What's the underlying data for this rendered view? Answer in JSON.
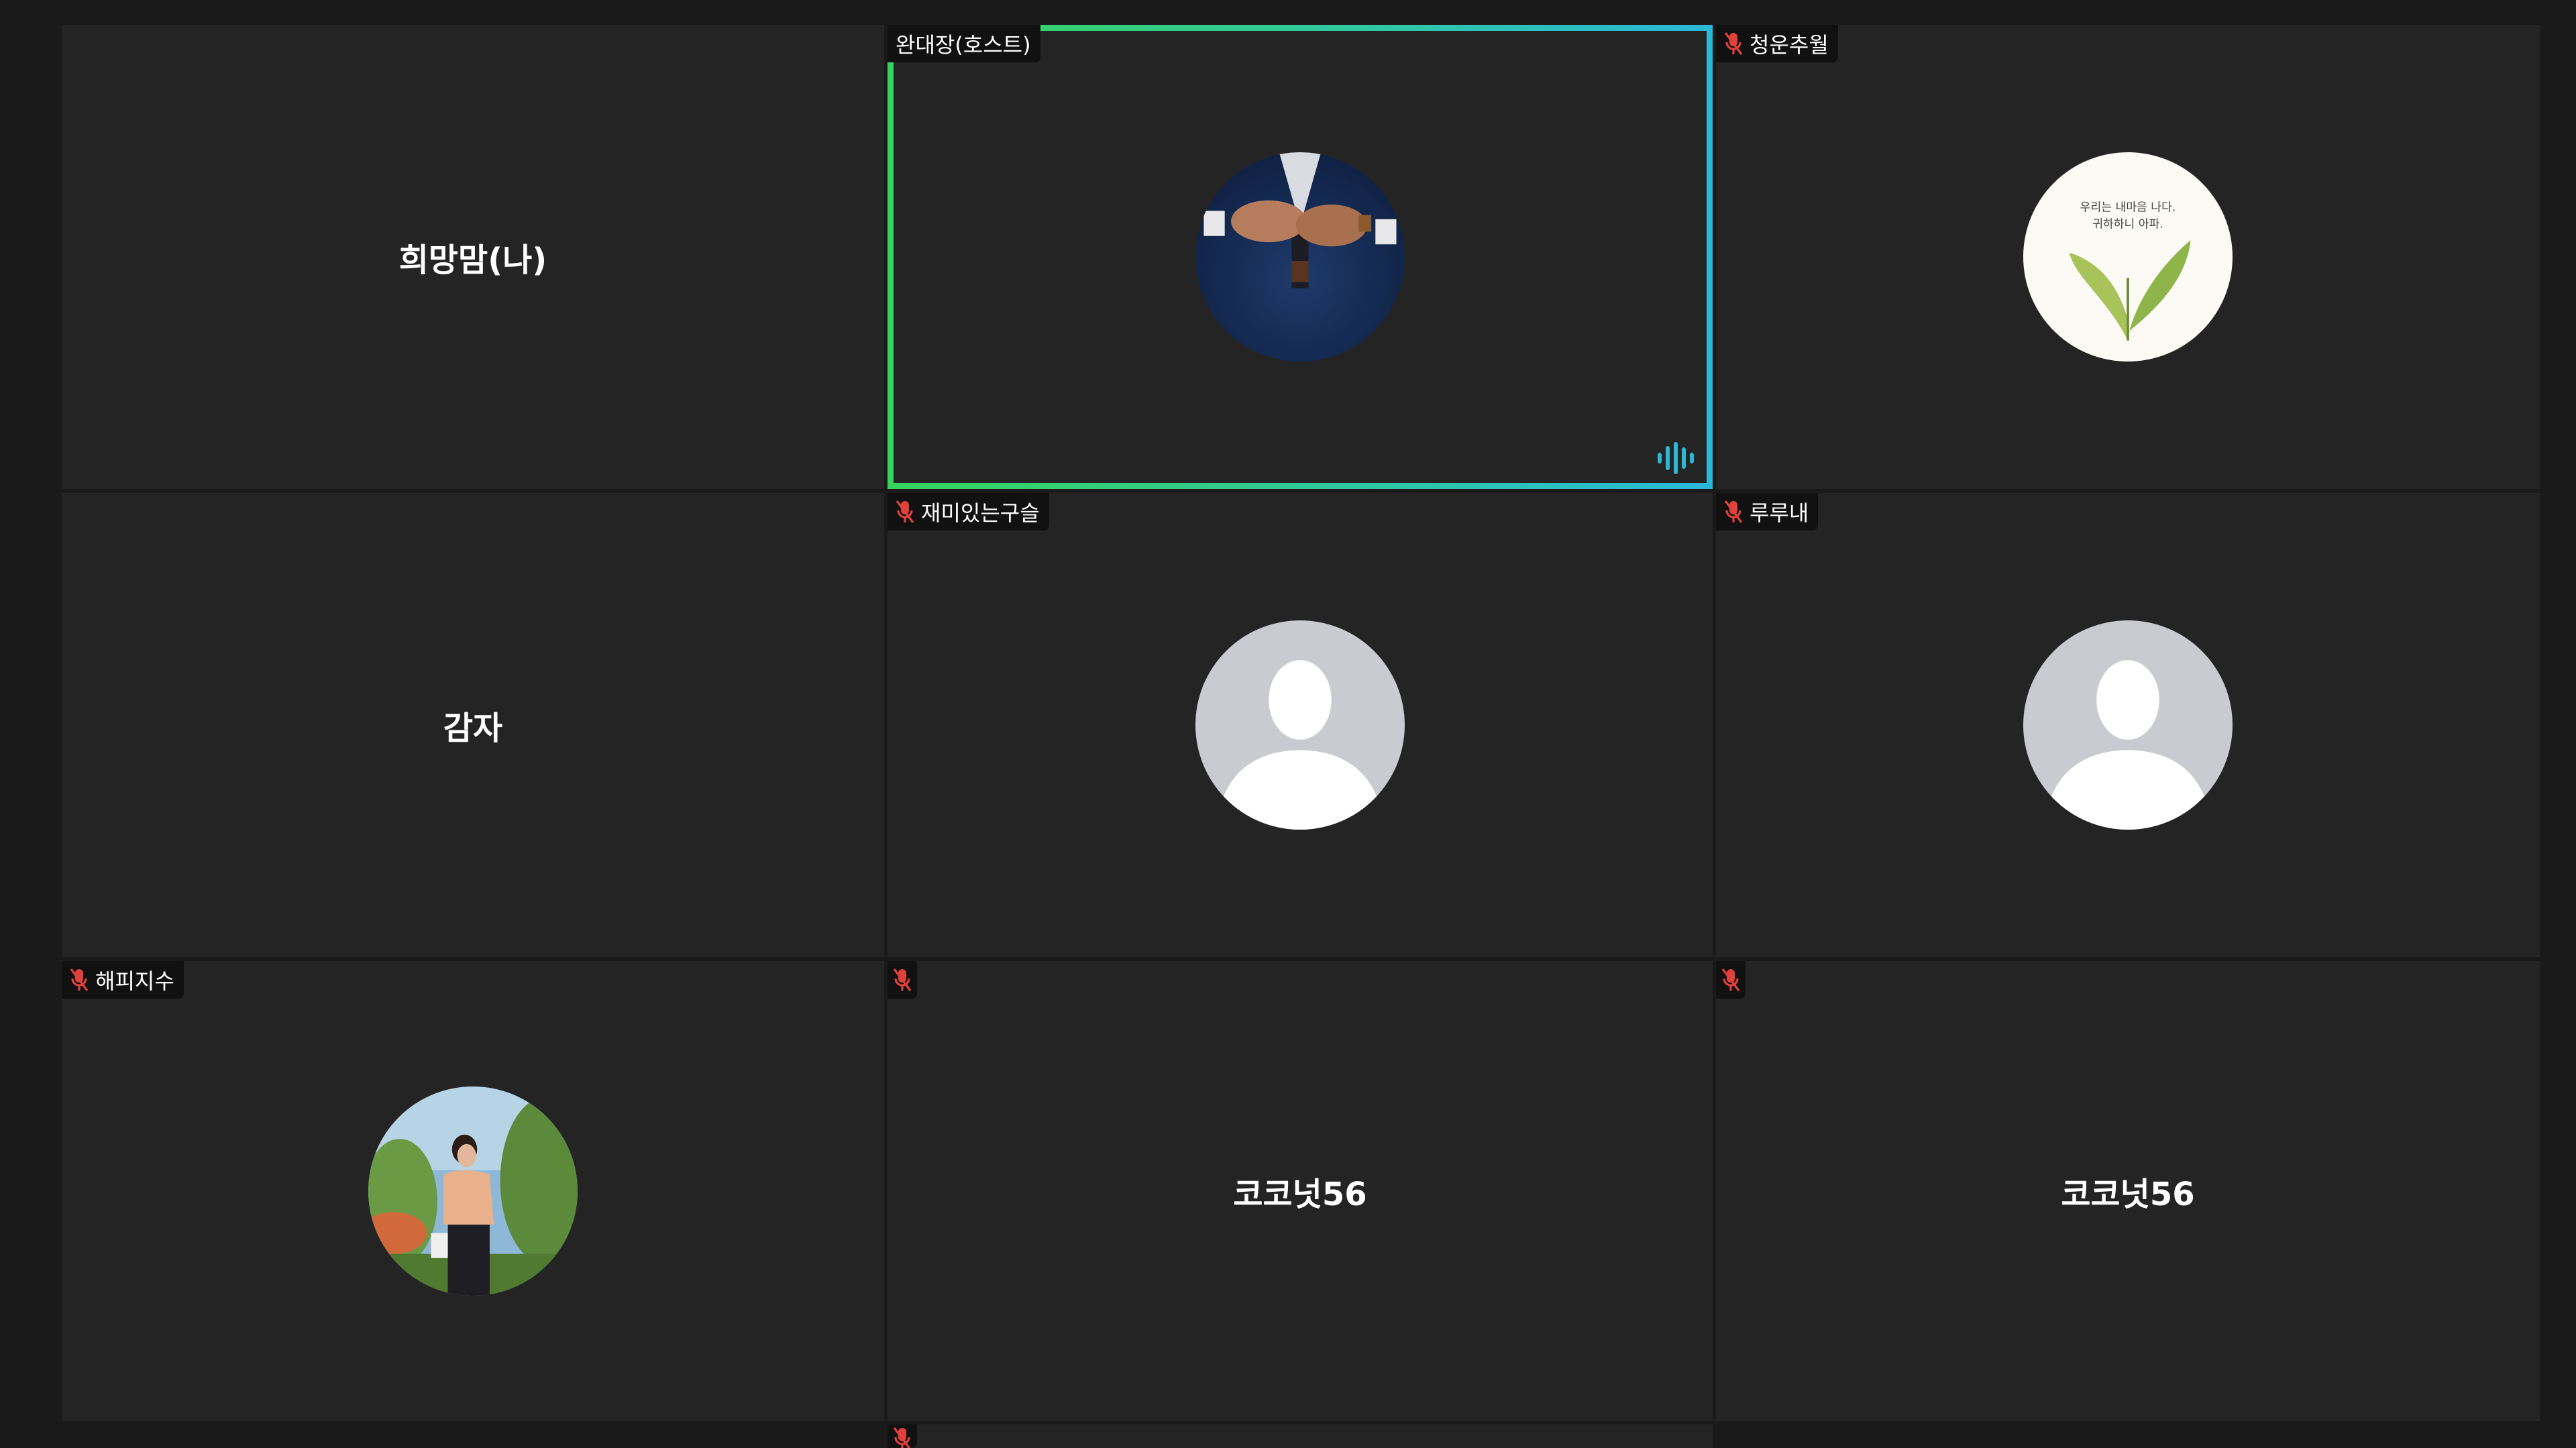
{
  "colors": {
    "background": "#1a1a1a",
    "tile": "#242424",
    "label_bg": "#111111",
    "active_border_start": "#36d45c",
    "active_border_end": "#2bb8d8",
    "muted_mic": "#e0413a",
    "speaking_indicator": "#2bb8d8"
  },
  "participants": [
    {
      "name": "희망맘(나)",
      "display": "name",
      "muted": false,
      "label_shown": false
    },
    {
      "name": "완대장(호스트)",
      "display": "photo",
      "muted": false,
      "label_shown": true,
      "active_speaker": true,
      "speaking_icon": "audio-level-icon"
    },
    {
      "name": "청운추월",
      "display": "photo",
      "muted": true,
      "label_shown": true
    },
    {
      "name": "감자",
      "display": "name",
      "muted": false,
      "label_shown": false
    },
    {
      "name": "재미있는구슬",
      "display": "default-avatar",
      "muted": true,
      "label_shown": true
    },
    {
      "name": "루루내",
      "display": "default-avatar",
      "muted": true,
      "label_shown": true
    },
    {
      "name": "해피지수",
      "display": "photo",
      "muted": true,
      "label_shown": true
    },
    {
      "name": "코코넛56",
      "display": "name",
      "muted": true,
      "label_shown": false
    },
    {
      "name": "코코넛56",
      "display": "name",
      "muted": true,
      "label_shown": false
    }
  ],
  "icons": {
    "mic": "muted-mic-icon",
    "avatar": "default-person-avatar-icon",
    "speaking": "audio-level-icon"
  }
}
